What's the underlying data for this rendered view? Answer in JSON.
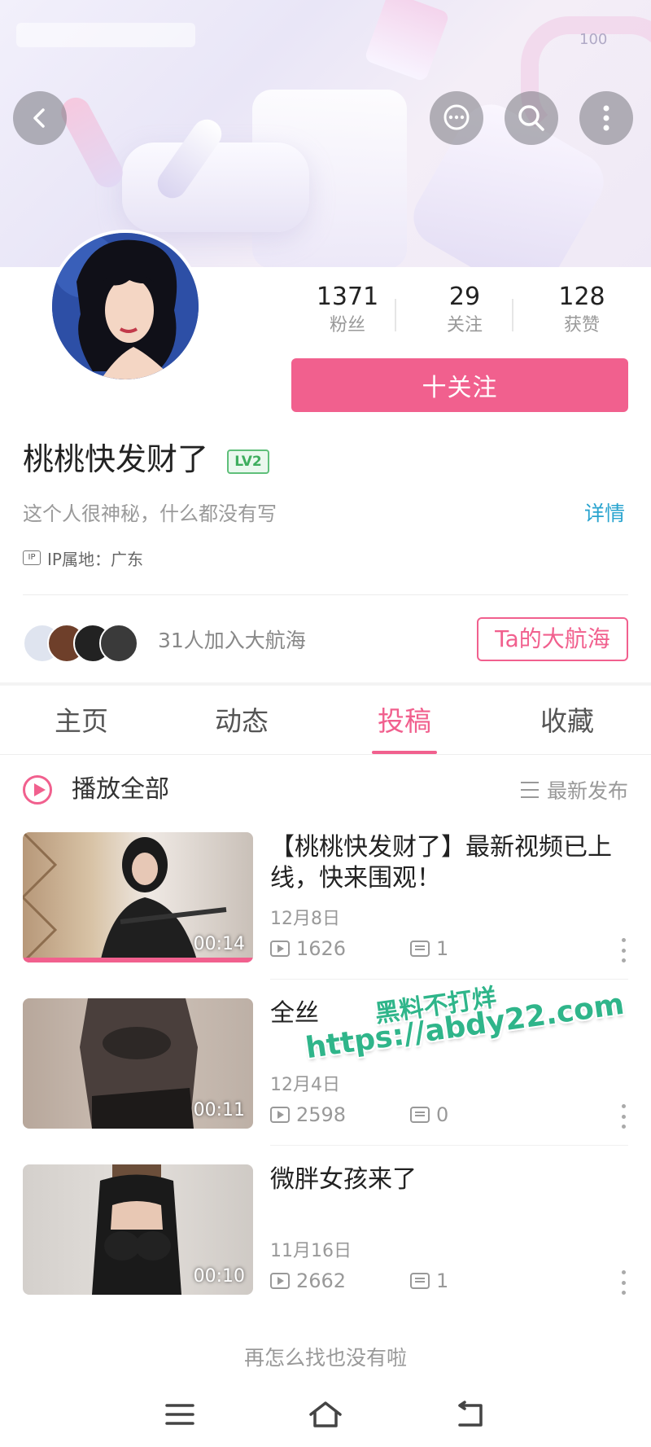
{
  "status_bar": {
    "battery": "100"
  },
  "header": {
    "back_icon": "chevron-left-icon",
    "message_icon": "chat-bubble-icon",
    "search_icon": "search-icon",
    "more_icon": "more-vertical-icon"
  },
  "profile": {
    "username": "桃桃快发财了",
    "level": "LV2",
    "bio": "这个人很神秘，什么都没有写",
    "detail_link": "详情",
    "ip_tag": "IP",
    "ip_location": "IP属地：广东",
    "stats": [
      {
        "value": "1371",
        "label": "粉丝"
      },
      {
        "value": "29",
        "label": "关注"
      },
      {
        "value": "128",
        "label": "获赞"
      }
    ],
    "follow_button": "十关注"
  },
  "fleet": {
    "text": "31人加入大航海",
    "button": "Ta的大航海"
  },
  "tabs": [
    {
      "label": "主页",
      "active": false
    },
    {
      "label": "动态",
      "active": false
    },
    {
      "label": "投稿",
      "active": true
    },
    {
      "label": "收藏",
      "active": false
    }
  ],
  "play_all": {
    "label": "播放全部",
    "sort": "最新发布"
  },
  "videos": [
    {
      "title": "【桃桃快发财了】最新视频已上线，快来围观！",
      "date": "12月8日",
      "duration": "00:14",
      "plays": "1626",
      "comments": "1",
      "watched": 1.0
    },
    {
      "title": "全丝",
      "date": "12月4日",
      "duration": "00:11",
      "plays": "2598",
      "comments": "0",
      "watched": 0
    },
    {
      "title": "微胖女孩来了",
      "date": "11月16日",
      "duration": "00:10",
      "plays": "2662",
      "comments": "1",
      "watched": 0
    }
  ],
  "end_text": "再怎么找也没有啦",
  "watermark": {
    "line1": "黑料不打烊",
    "line2": "https://abdy22.com"
  },
  "colors": {
    "accent": "#f1608e",
    "link": "#2aa4cf",
    "level": "#3fae5f"
  }
}
